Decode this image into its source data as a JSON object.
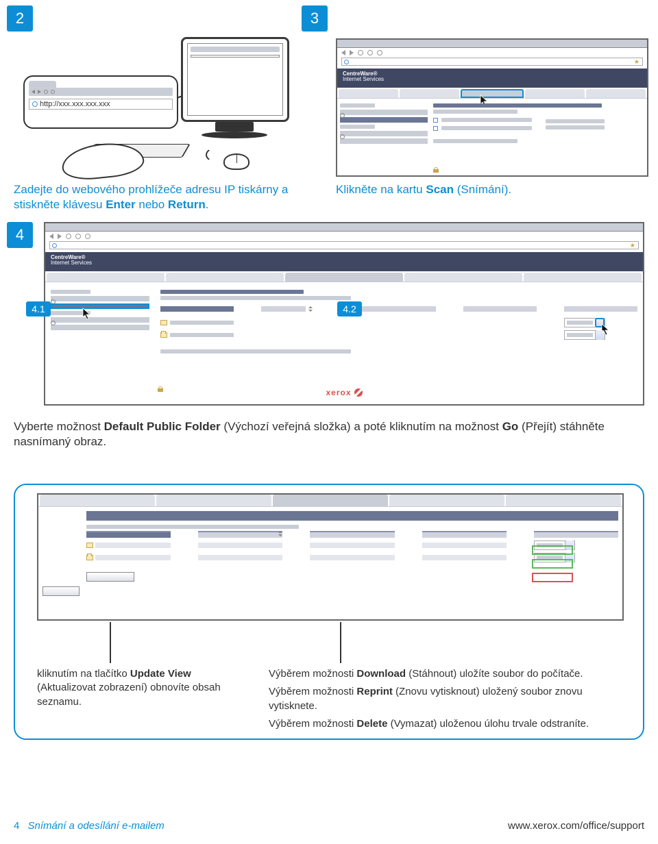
{
  "steps": {
    "s2": {
      "num": "2"
    },
    "s3": {
      "num": "3"
    },
    "s4": {
      "num": "4"
    },
    "s41": {
      "num": "4.1"
    },
    "s42": {
      "num": "4.2"
    }
  },
  "browser_callout": {
    "url": "http://xxx.xxx.xxx.xxx"
  },
  "centreware": {
    "line1": "CentreWare®",
    "line2": "Internet Services"
  },
  "xerox": "xerox",
  "instructions": {
    "step2_pre": "Zadejte do webového prohlížeče adresu IP tiskárny a stiskněte klávesu ",
    "step2_key1": "Enter",
    "step2_mid": " nebo ",
    "step2_key2": "Return",
    "step2_end": ".",
    "step3_pre": "Klikněte na kartu ",
    "step3_b": "Scan",
    "step3_post": " (Snímání).",
    "step4_pre": "Vyberte možnost ",
    "step4_b1": "Default Public Folder",
    "step4_mid1": " (Výchozí veřejná složka) a poté kliknutím na možnost ",
    "step4_b2": "Go",
    "step4_mid2": " (Přejít) stáhněte nasnímaný obraz."
  },
  "detail": {
    "left_pre": "kliknutím na tlačítko ",
    "left_b": "Update View",
    "left_post": " (Aktualizovat zobrazení) obnovíte obsah seznamu.",
    "r1_pre": "Výběrem možnosti ",
    "r1_b": "Download",
    "r1_post": " (Stáhnout) uložíte soubor do počítače.",
    "r2_pre": "Výběrem možnosti ",
    "r2_b": "Reprint",
    "r2_post": " (Znovu vytisknout) uložený soubor znovu vytisknete.",
    "r3_pre": "Výběrem možnosti ",
    "r3_b": "Delete",
    "r3_post": " (Vymazat) uloženou úlohu trvale odstraníte."
  },
  "footer": {
    "page": "4",
    "title": "Snímání a odesílání e-mailem",
    "url": "www.xerox.com/office/support"
  }
}
